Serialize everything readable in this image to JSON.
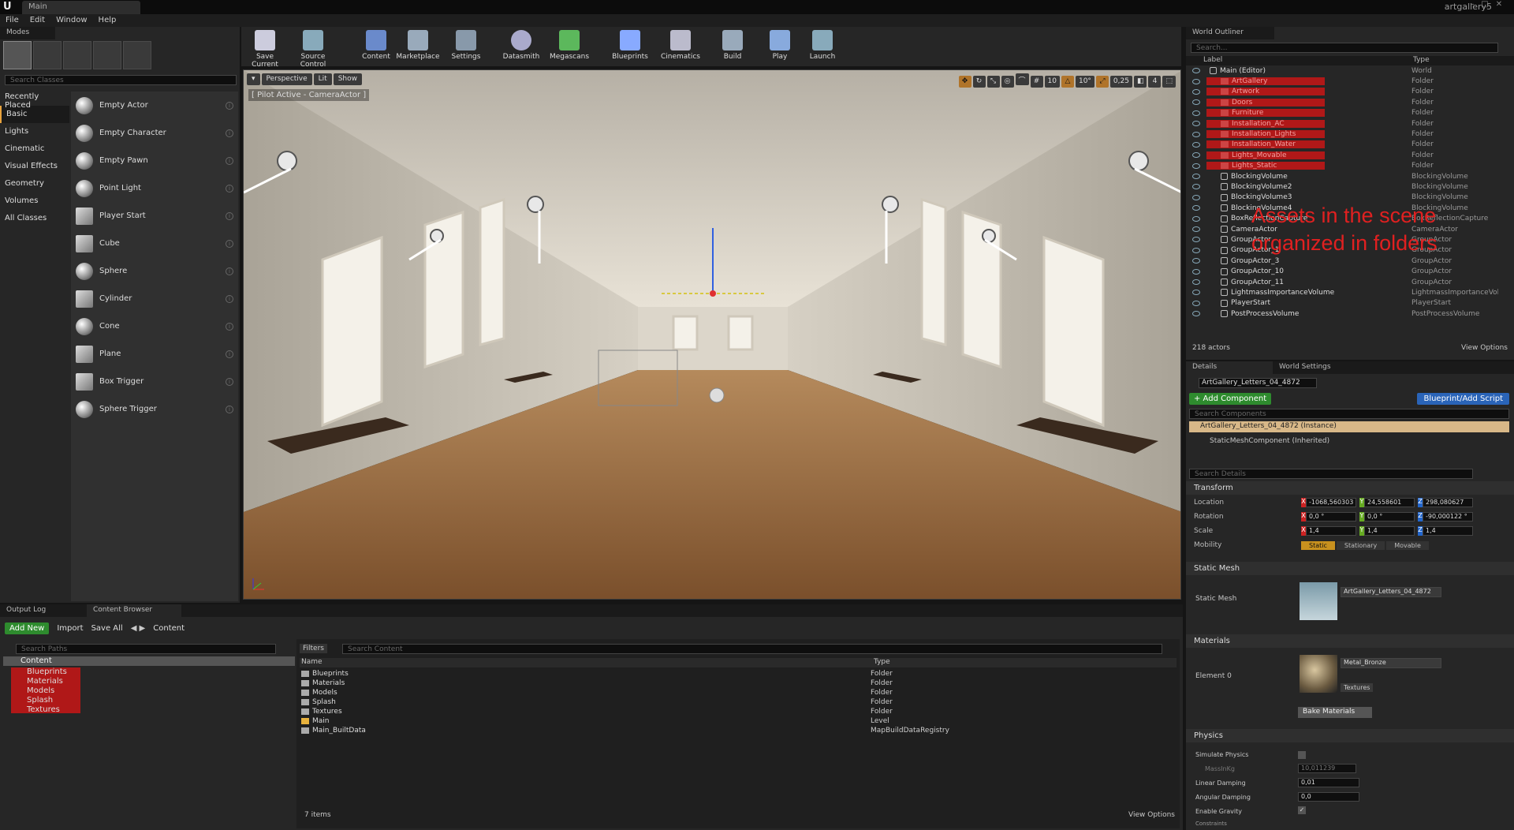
{
  "app": {
    "tab": "Main",
    "project": "artgallery5"
  },
  "menu": [
    "File",
    "Edit",
    "Window",
    "Help"
  ],
  "modes": {
    "title": "Modes",
    "search_placeholder": "Search Classes",
    "categories": [
      "Recently Placed",
      "Basic",
      "Lights",
      "Cinematic",
      "Visual Effects",
      "Geometry",
      "Volumes",
      "All Classes"
    ],
    "selected_category": "Basic",
    "classes": [
      "Empty Actor",
      "Empty Character",
      "Empty Pawn",
      "Point Light",
      "Player Start",
      "Cube",
      "Sphere",
      "Cylinder",
      "Cone",
      "Plane",
      "Box Trigger",
      "Sphere Trigger"
    ]
  },
  "toolbar": [
    "Save Current",
    "Source Control",
    "Content",
    "Marketplace",
    "Settings",
    "Datasmith",
    "Megascans",
    "Blueprints",
    "Cinematics",
    "Build",
    "Play",
    "Launch"
  ],
  "viewport": {
    "perspective": "Perspective",
    "lit": "Lit",
    "show": "Show",
    "pilot": "[ Pilot Active - CameraActor ]",
    "snap_grid": "10",
    "snap_rot": "10°",
    "snap_scale": "0,25",
    "cam_speed": "4"
  },
  "outliner": {
    "title": "World Outliner",
    "search_placeholder": "Search...",
    "col_label": "Label",
    "col_type": "Type",
    "rows": [
      {
        "label": "Main (Editor)",
        "type": "World",
        "kind": "world"
      },
      {
        "label": "ArtGallery",
        "type": "Folder",
        "kind": "folder"
      },
      {
        "label": "Artwork",
        "type": "Folder",
        "kind": "folder"
      },
      {
        "label": "Doors",
        "type": "Folder",
        "kind": "folder"
      },
      {
        "label": "Furniture",
        "type": "Folder",
        "kind": "folder"
      },
      {
        "label": "Installation_AC",
        "type": "Folder",
        "kind": "folder"
      },
      {
        "label": "Installation_Lights",
        "type": "Folder",
        "kind": "folder"
      },
      {
        "label": "Installation_Water",
        "type": "Folder",
        "kind": "folder"
      },
      {
        "label": "Lights_Movable",
        "type": "Folder",
        "kind": "folder"
      },
      {
        "label": "Lights_Static",
        "type": "Folder",
        "kind": "folder"
      },
      {
        "label": "BlockingVolume",
        "type": "BlockingVolume",
        "kind": "actor"
      },
      {
        "label": "BlockingVolume2",
        "type": "BlockingVolume",
        "kind": "actor"
      },
      {
        "label": "BlockingVolume3",
        "type": "BlockingVolume",
        "kind": "actor"
      },
      {
        "label": "BlockingVolume4",
        "type": "BlockingVolume",
        "kind": "actor"
      },
      {
        "label": "BoxReflectionCapture",
        "type": "BoxReflectionCapture",
        "kind": "actor"
      },
      {
        "label": "CameraActor",
        "type": "CameraActor",
        "kind": "actor"
      },
      {
        "label": "GroupActor",
        "type": "GroupActor",
        "kind": "actor"
      },
      {
        "label": "GroupActor_1",
        "type": "GroupActor",
        "kind": "actor"
      },
      {
        "label": "GroupActor_3",
        "type": "GroupActor",
        "kind": "actor"
      },
      {
        "label": "GroupActor_10",
        "type": "GroupActor",
        "kind": "actor"
      },
      {
        "label": "GroupActor_11",
        "type": "GroupActor",
        "kind": "actor"
      },
      {
        "label": "LightmassImportanceVolume",
        "type": "LightmassImportanceVolume",
        "kind": "actor"
      },
      {
        "label": "PlayerStart",
        "type": "PlayerStart",
        "kind": "actor"
      },
      {
        "label": "PostProcessVolume",
        "type": "PostProcessVolume",
        "kind": "actor"
      }
    ],
    "count": "218 actors",
    "view_options": "View Options",
    "annotation": "Assets in the scene organized in folders"
  },
  "details": {
    "tab1": "Details",
    "tab2": "World Settings",
    "actor_name": "ArtGallery_Letters_04_4872",
    "add_component": "+ Add Component",
    "blueprint": "Blueprint/Add Script",
    "search_components": "Search Components",
    "instance": "ArtGallery_Letters_04_4872 (Instance)",
    "component": "StaticMeshComponent (Inherited)",
    "search_details": "Search Details",
    "transform": "Transform",
    "location_label": "Location",
    "rotation_label": "Rotation",
    "scale_label": "Scale",
    "mobility_label": "Mobility",
    "location": [
      "-1068,560303",
      "24,558601",
      "298,080627"
    ],
    "rotation": [
      "0,0 °",
      "0,0 °",
      "-90,000122 °"
    ],
    "scale": [
      "1,4",
      "1,4",
      "1,4"
    ],
    "mobility": [
      "Static",
      "Stationary",
      "Movable"
    ],
    "static_mesh_section": "Static Mesh",
    "static_mesh_label": "Static Mesh",
    "static_mesh_value": "ArtGallery_Letters_04_4872",
    "materials_section": "Materials",
    "element0": "Element 0",
    "material_value": "Metal_Bronze",
    "textures": "Textures",
    "bake": "Bake Materials",
    "physics": "Physics",
    "simulate": "Simulate Physics",
    "mass_label": "MassInKg",
    "mass": "10,011239",
    "lin_damp_label": "Linear Damping",
    "lin_damp": "0,01",
    "ang_damp_label": "Angular Damping",
    "ang_damp": "0,0",
    "gravity": "Enable Gravity",
    "constraints": "Constraints"
  },
  "content_browser": {
    "tab_log": "Output Log",
    "tab_cb": "Content Browser",
    "add_new": "Add New",
    "import": "Import",
    "save_all": "Save All",
    "path": "Content",
    "search_paths": "Search Paths",
    "filters": "Filters",
    "search_content": "Search Content",
    "tree_root": "Content",
    "tree": [
      "Blueprints",
      "Materials",
      "Models",
      "Splash",
      "Textures"
    ],
    "col_name": "Name",
    "col_type": "Type",
    "items": [
      {
        "name": "Blueprints",
        "type": "Folder"
      },
      {
        "name": "Materials",
        "type": "Folder"
      },
      {
        "name": "Models",
        "type": "Folder"
      },
      {
        "name": "Splash",
        "type": "Folder"
      },
      {
        "name": "Textures",
        "type": "Folder"
      },
      {
        "name": "Main",
        "type": "Level"
      },
      {
        "name": "Main_BuiltData",
        "type": "MapBuildDataRegistry"
      }
    ],
    "count": "7 items",
    "view_options": "View Options"
  }
}
